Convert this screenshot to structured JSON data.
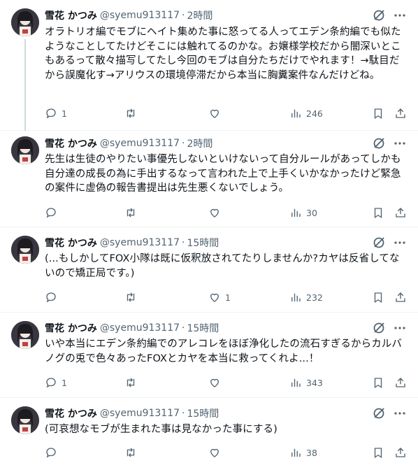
{
  "user": {
    "name": "雪花 かつみ",
    "handle": "@syemu913117"
  },
  "tweets": [
    {
      "time": "2時間",
      "text": "オラトリオ編でモブにヘイト集めた事に怒ってる人ってエデン条約編でも似たようなことしてたけどそこには触れてるのかな。お嬢様学校だから闇深いとこもあるって散々描写してたし今回のモブは自分たちだけでやれます！→駄目だから誤魔化す→アリウスの環境停滞だから本当に胸糞案件なんだけどね。",
      "replies": "1",
      "retweets": "",
      "likes": "",
      "views": "246"
    },
    {
      "time": "2時間",
      "text": "先生は生徒のやりたい事優先しないといけないって自分ルールがあってしかも自分達の成長の為に手出するなって言われた上で上手くいかなかったけど緊急の案件に虚偽の報告書提出は先生悪くないでしょう。",
      "replies": "",
      "retweets": "",
      "likes": "",
      "views": "30"
    },
    {
      "time": "15時間",
      "text": "(...もしかしてFOX小隊は既に仮釈放されてたりしませんか?カヤは反省してないので矯正局です。)",
      "replies": "",
      "retweets": "",
      "likes": "1",
      "views": "232"
    },
    {
      "time": "15時間",
      "text": "いや本当にエデン条約編でのアレコレをほぼ浄化したの流石すぎるからカルバノグの兎で色々あったFOXとカヤを本当に救ってくれよ...！",
      "replies": "1",
      "retweets": "",
      "likes": "",
      "views": "343"
    },
    {
      "time": "15時間",
      "text": "(可哀想なモブが生まれた事は見なかった事にする)",
      "replies": "",
      "retweets": "",
      "likes": "",
      "views": "38"
    }
  ],
  "icons": {
    "reply": "speech-bubble-icon",
    "retweet": "retweet-arrows-icon",
    "like": "heart-icon",
    "views": "bar-chart-icon",
    "bookmark": "bookmark-icon",
    "share": "share-upload-icon",
    "grok": "grok-slash-circle-icon",
    "more": "three-dots-icon"
  },
  "colors": {
    "text": "#0f1419",
    "secondary": "#536471",
    "divider": "#eff3f4",
    "thread": "#cfd9de"
  }
}
